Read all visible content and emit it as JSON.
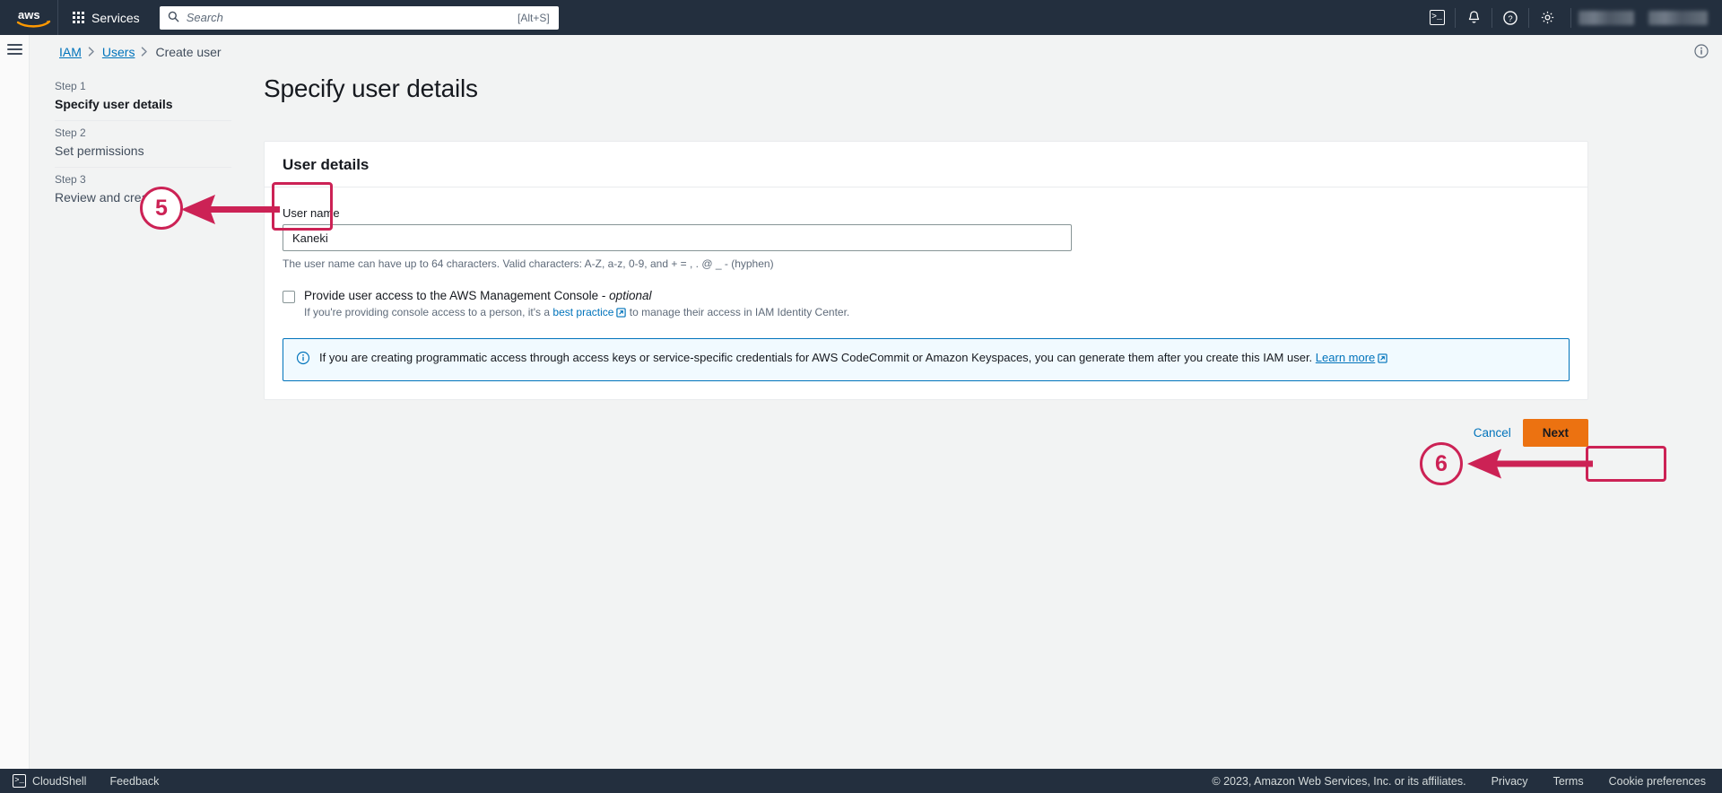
{
  "topnav": {
    "logo_alt": "aws",
    "services_label": "Services",
    "search": {
      "placeholder": "Search",
      "shortcut": "[Alt+S]"
    },
    "icons": [
      {
        "name": "cloudshell-icon",
        "glyph": ">_"
      },
      {
        "name": "notifications-bell-icon",
        "glyph": "⚑"
      },
      {
        "name": "help-question-icon",
        "glyph": "?"
      },
      {
        "name": "settings-gear-icon",
        "glyph": "⚙"
      }
    ],
    "region_selector": "",
    "account_menu": ""
  },
  "breadcrumb": {
    "items": [
      {
        "label": "IAM",
        "link": true
      },
      {
        "label": "Users",
        "link": true
      },
      {
        "label": "Create user",
        "link": false
      }
    ],
    "separator": "›"
  },
  "wizard": {
    "steps": [
      {
        "number": "Step 1",
        "label": "Specify user details",
        "active": true
      },
      {
        "number": "Step 2",
        "label": "Set permissions",
        "active": false
      },
      {
        "number": "Step 3",
        "label": "Review and create",
        "active": false
      }
    ]
  },
  "main": {
    "page_title": "Specify user details",
    "card": {
      "title": "User details",
      "username_field": {
        "label": "User name",
        "value": "Kaneki",
        "placeholder": "",
        "help": "The user name can have up to 64 characters. Valid characters: A-Z, a-z, 0-9, and + = , . @ _ - (hyphen)"
      },
      "console_access": {
        "checked": false,
        "label": "Provide user access to the AWS Management Console - ",
        "optional_word": "optional",
        "sub_prefix": "If you're providing console access to a person, it's a ",
        "sub_link": "best practice",
        "sub_suffix": " to manage their access in IAM Identity Center."
      },
      "alert": {
        "icon": "info-icon",
        "text": "If you are creating programmatic access through access keys or service-specific credentials for AWS CodeCommit or Amazon Keyspaces, you can generate them after you create this IAM user. ",
        "link": "Learn more"
      }
    },
    "actions": {
      "cancel": "Cancel",
      "next": "Next"
    }
  },
  "footer": {
    "cloudshell": "CloudShell",
    "feedback": "Feedback",
    "copyright": "© 2023, Amazon Web Services, Inc. or its affiliates.",
    "privacy": "Privacy",
    "terms": "Terms",
    "cookie_preferences": "Cookie preferences"
  },
  "annotations": {
    "color": "#cc2255",
    "markers": [
      {
        "number": "5",
        "target": "user-name-field"
      },
      {
        "number": "6",
        "target": "next-button"
      }
    ]
  }
}
